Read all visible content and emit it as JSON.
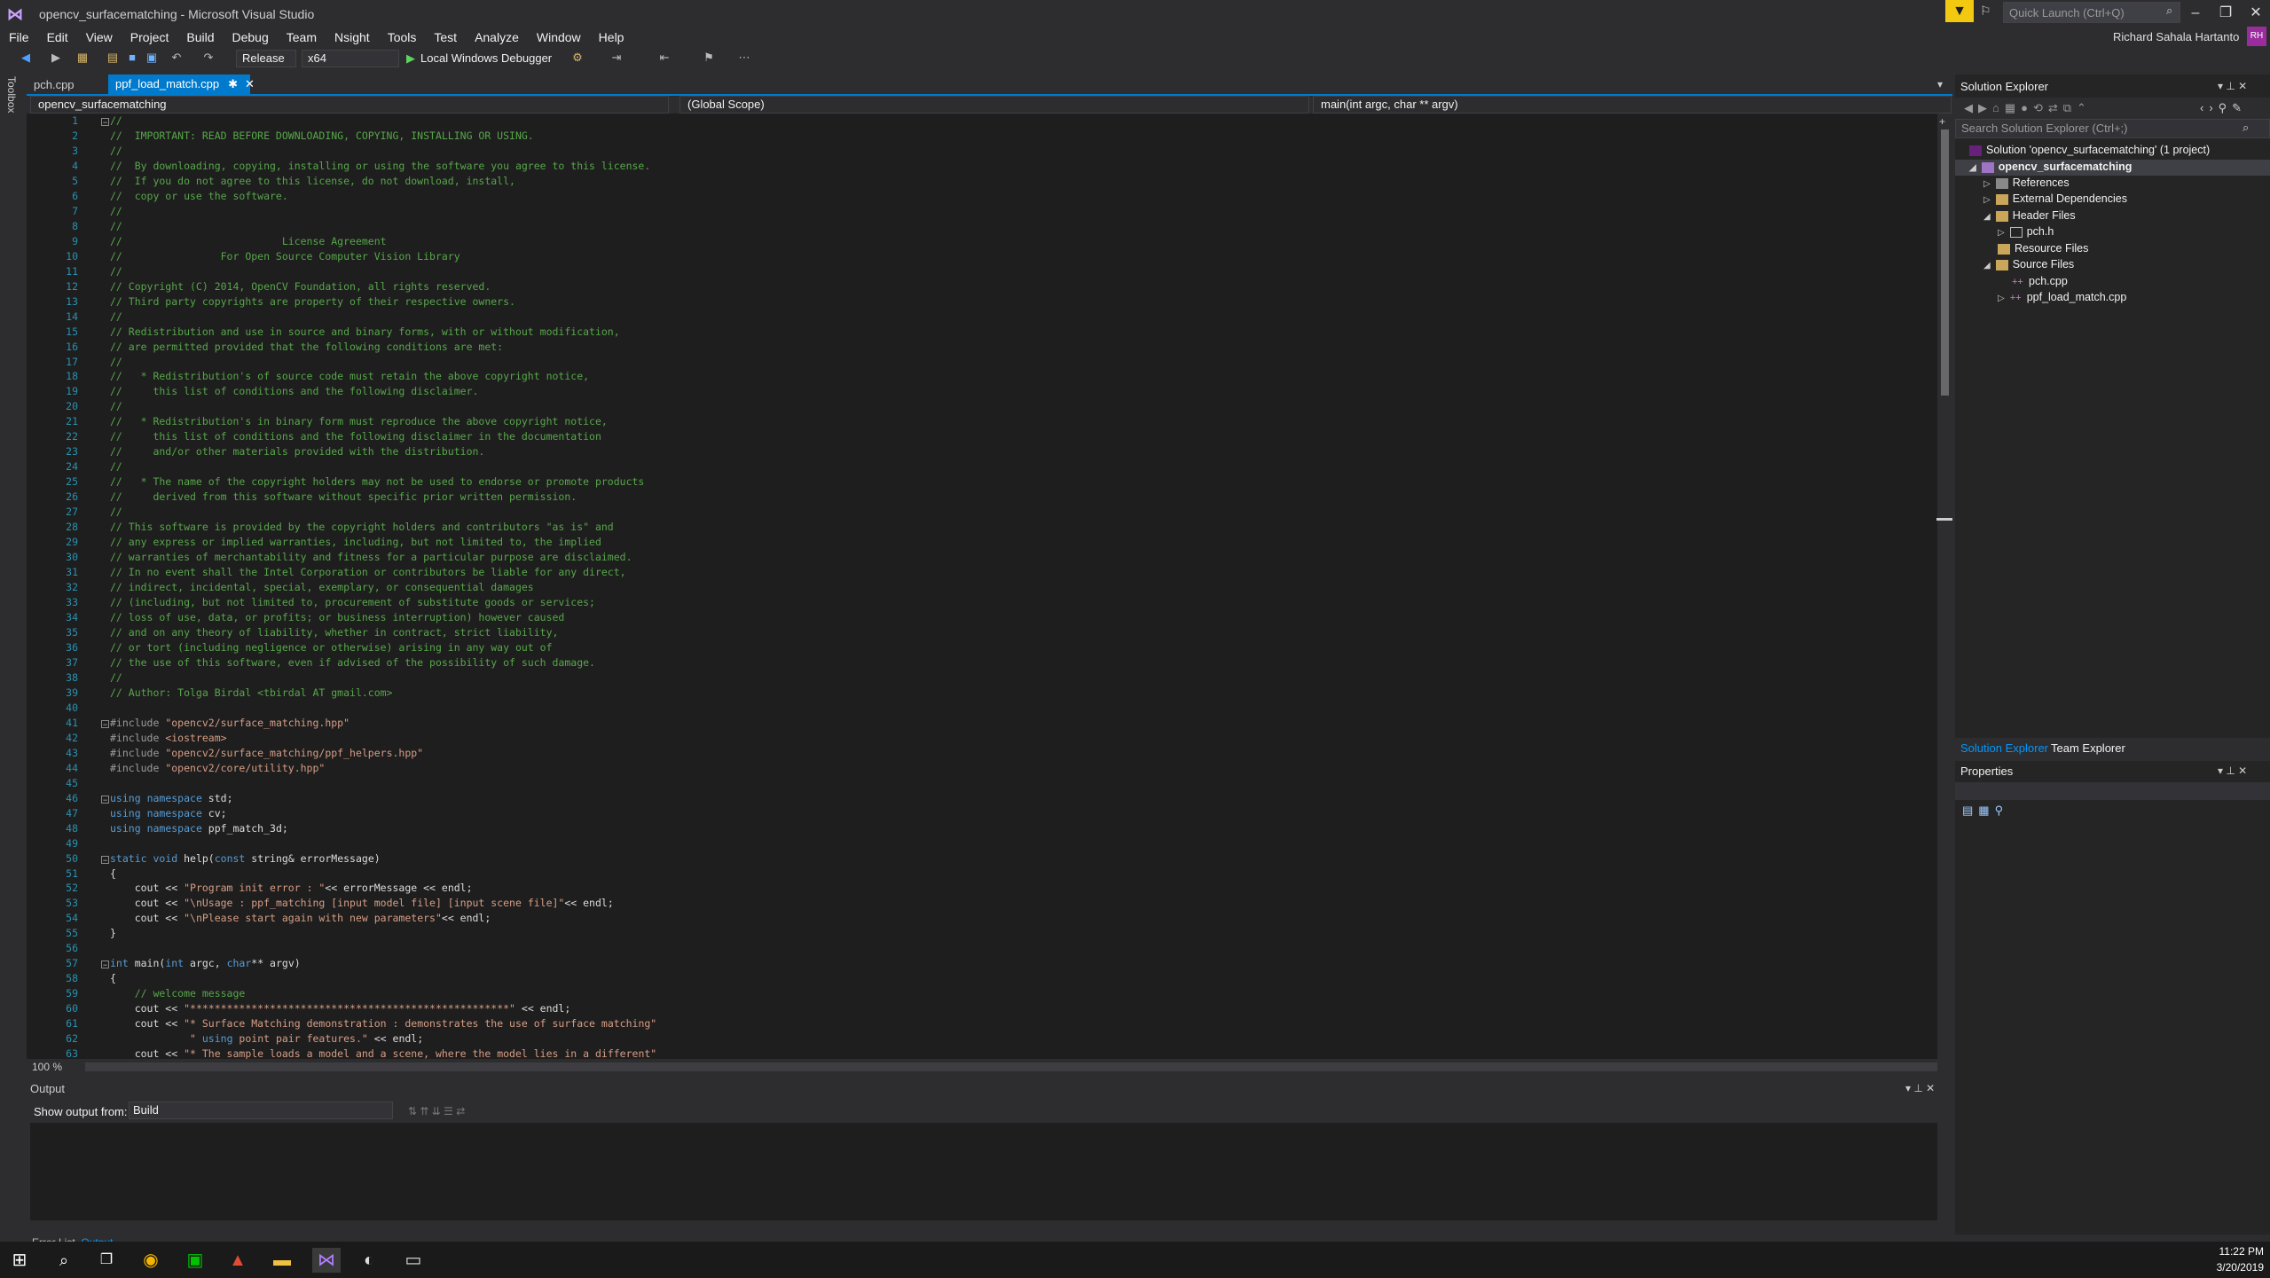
{
  "window": {
    "title": "opencv_surfacematching - Microsoft Visual Studio",
    "quick_launch_placeholder": "Quick Launch (Ctrl+Q)",
    "user_name": "Richard Sahala Hartanto",
    "user_initials": "RH"
  },
  "menu": [
    "File",
    "Edit",
    "View",
    "Project",
    "Build",
    "Debug",
    "Team",
    "Nsight",
    "Tools",
    "Test",
    "Analyze",
    "Window",
    "Help"
  ],
  "toolbar": {
    "configuration": "Release",
    "platform": "x64",
    "run_label": "Local Windows Debugger"
  },
  "toolbox_label": "Toolbox",
  "tabs": [
    {
      "label": "pch.cpp",
      "active": false
    },
    {
      "label": "ppf_load_match.cpp",
      "active": true
    }
  ],
  "navbar": {
    "project": "opencv_surfacematching",
    "scope": "(Global Scope)",
    "member": "main(int argc, char ** argv)"
  },
  "editor": {
    "line_numbers": [
      "1",
      "2",
      "3",
      "4",
      "5",
      "6",
      "7",
      "8",
      "9",
      "10",
      "11",
      "12",
      "13",
      "14",
      "15",
      "16",
      "17",
      "18",
      "19",
      "20",
      "21",
      "22",
      "23",
      "24",
      "25",
      "26",
      "27",
      "28",
      "29",
      "30",
      "31",
      "32",
      "33",
      "34",
      "35",
      "36",
      "37",
      "38",
      "39",
      "40",
      "41",
      "42",
      "43",
      "44",
      "45",
      "46",
      "47",
      "48",
      "49",
      "50",
      "51",
      "52",
      "53",
      "54",
      "55",
      "56",
      "57",
      "58",
      "59",
      "60",
      "61",
      "62",
      "63"
    ],
    "lines": [
      "//",
      "//  IMPORTANT: READ BEFORE DOWNLOADING, COPYING, INSTALLING OR USING.",
      "//",
      "//  By downloading, copying, installing or using the software you agree to this license.",
      "//  If you do not agree to this license, do not download, install,",
      "//  copy or use the software.",
      "//",
      "//",
      "//                          License Agreement",
      "//                For Open Source Computer Vision Library",
      "//",
      "// Copyright (C) 2014, OpenCV Foundation, all rights reserved.",
      "// Third party copyrights are property of their respective owners.",
      "//",
      "// Redistribution and use in source and binary forms, with or without modification,",
      "// are permitted provided that the following conditions are met:",
      "//",
      "//   * Redistribution's of source code must retain the above copyright notice,",
      "//     this list of conditions and the following disclaimer.",
      "//",
      "//   * Redistribution's in binary form must reproduce the above copyright notice,",
      "//     this list of conditions and the following disclaimer in the documentation",
      "//     and/or other materials provided with the distribution.",
      "//",
      "//   * The name of the copyright holders may not be used to endorse or promote products",
      "//     derived from this software without specific prior written permission.",
      "//",
      "// This software is provided by the copyright holders and contributors \"as is\" and",
      "// any express or implied warranties, including, but not limited to, the implied",
      "// warranties of merchantability and fitness for a particular purpose are disclaimed.",
      "// In no event shall the Intel Corporation or contributors be liable for any direct,",
      "// indirect, incidental, special, exemplary, or consequential damages",
      "// (including, but not limited to, procurement of substitute goods or services;",
      "// loss of use, data, or profits; or business interruption) however caused",
      "// and on any theory of liability, whether in contract, strict liability,",
      "// or tort (including negligence or otherwise) arising in any way out of",
      "// the use of this software, even if advised of the possibility of such damage.",
      "//",
      "// Author: Tolga Birdal <tbirdal AT gmail.com>",
      "",
      "#include \"opencv2/surface_matching.hpp\"",
      "#include <iostream>",
      "#include \"opencv2/surface_matching/ppf_helpers.hpp\"",
      "#include \"opencv2/core/utility.hpp\"",
      "",
      "using namespace std;",
      "using namespace cv;",
      "using namespace ppf_match_3d;",
      "",
      "static void help(const string& errorMessage)",
      "{",
      "    cout << \"Program init error : \"<< errorMessage << endl;",
      "    cout << \"\\nUsage : ppf_matching [input model file] [input scene file]\"<< endl;",
      "    cout << \"\\nPlease start again with new parameters\"<< endl;",
      "}",
      "",
      "int main(int argc, char** argv)",
      "{",
      "    // welcome message",
      "    cout << \"****************************************************\" << endl;",
      "    cout << \"* Surface Matching demonstration : demonstrates the use of surface matching\"",
      "             \" using point pair features.\" << endl;",
      "    cout << \"* The sample loads a model and a scene, where the model lies in a different\""
    ]
  },
  "status": {
    "zoom": "100 %"
  },
  "output": {
    "title": "Output",
    "show_from_label": "Show output from:",
    "source": "Build",
    "bottom_tabs": [
      "Error List",
      "Output"
    ]
  },
  "solution_explorer": {
    "title": "Solution Explorer",
    "search_placeholder": "Search Solution Explorer (Ctrl+;)",
    "solution": "Solution 'opencv_surfacematching' (1 project)",
    "project": "opencv_surfacematching",
    "nodes": [
      "References",
      "External Dependencies",
      "Header Files",
      "pch.h",
      "Resource Files",
      "Source Files",
      "pch.cpp",
      "ppf_load_match.cpp"
    ],
    "tabs": [
      "Solution Explorer",
      "Team Explorer"
    ]
  },
  "properties": {
    "title": "Properties"
  },
  "taskbar": {
    "time": "11:22 PM",
    "date": "3/20/2019"
  },
  "colors": {
    "accent": "#007acc",
    "comment": "#57a64a",
    "keyword": "#569cd6",
    "string": "#d69d85",
    "line_number": "#2b91af"
  }
}
